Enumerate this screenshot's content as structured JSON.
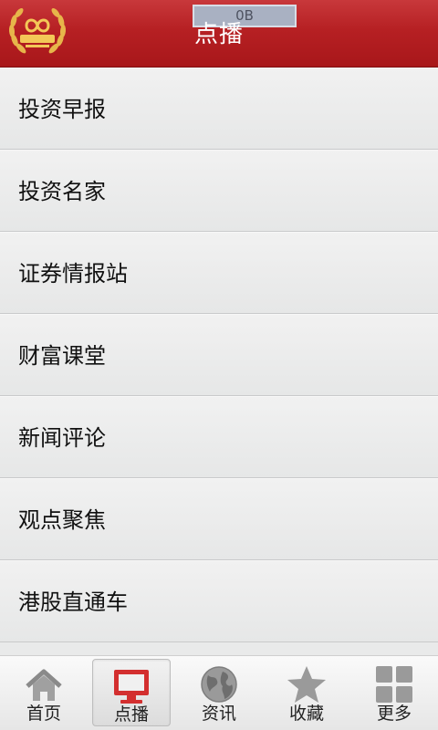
{
  "header": {
    "title": "点播",
    "data_counter": "0B",
    "logo_icon": "caijing-china-logo-icon"
  },
  "list": {
    "items": [
      {
        "label": "投资早报"
      },
      {
        "label": "投资名家"
      },
      {
        "label": "证券情报站"
      },
      {
        "label": "财富课堂"
      },
      {
        "label": "新闻评论"
      },
      {
        "label": "观点聚焦"
      },
      {
        "label": "港股直通车"
      }
    ]
  },
  "tabbar": {
    "active_index": 1,
    "tabs": [
      {
        "label": "首页",
        "icon": "home-icon"
      },
      {
        "label": "点播",
        "icon": "monitor-icon"
      },
      {
        "label": "资讯",
        "icon": "globe-icon"
      },
      {
        "label": "收藏",
        "icon": "star-icon"
      },
      {
        "label": "更多",
        "icon": "grid-icon"
      }
    ]
  },
  "colors": {
    "header_red": "#b62023",
    "active_tab_red": "#d32f2f",
    "icon_gray": "#8a8a8a"
  }
}
